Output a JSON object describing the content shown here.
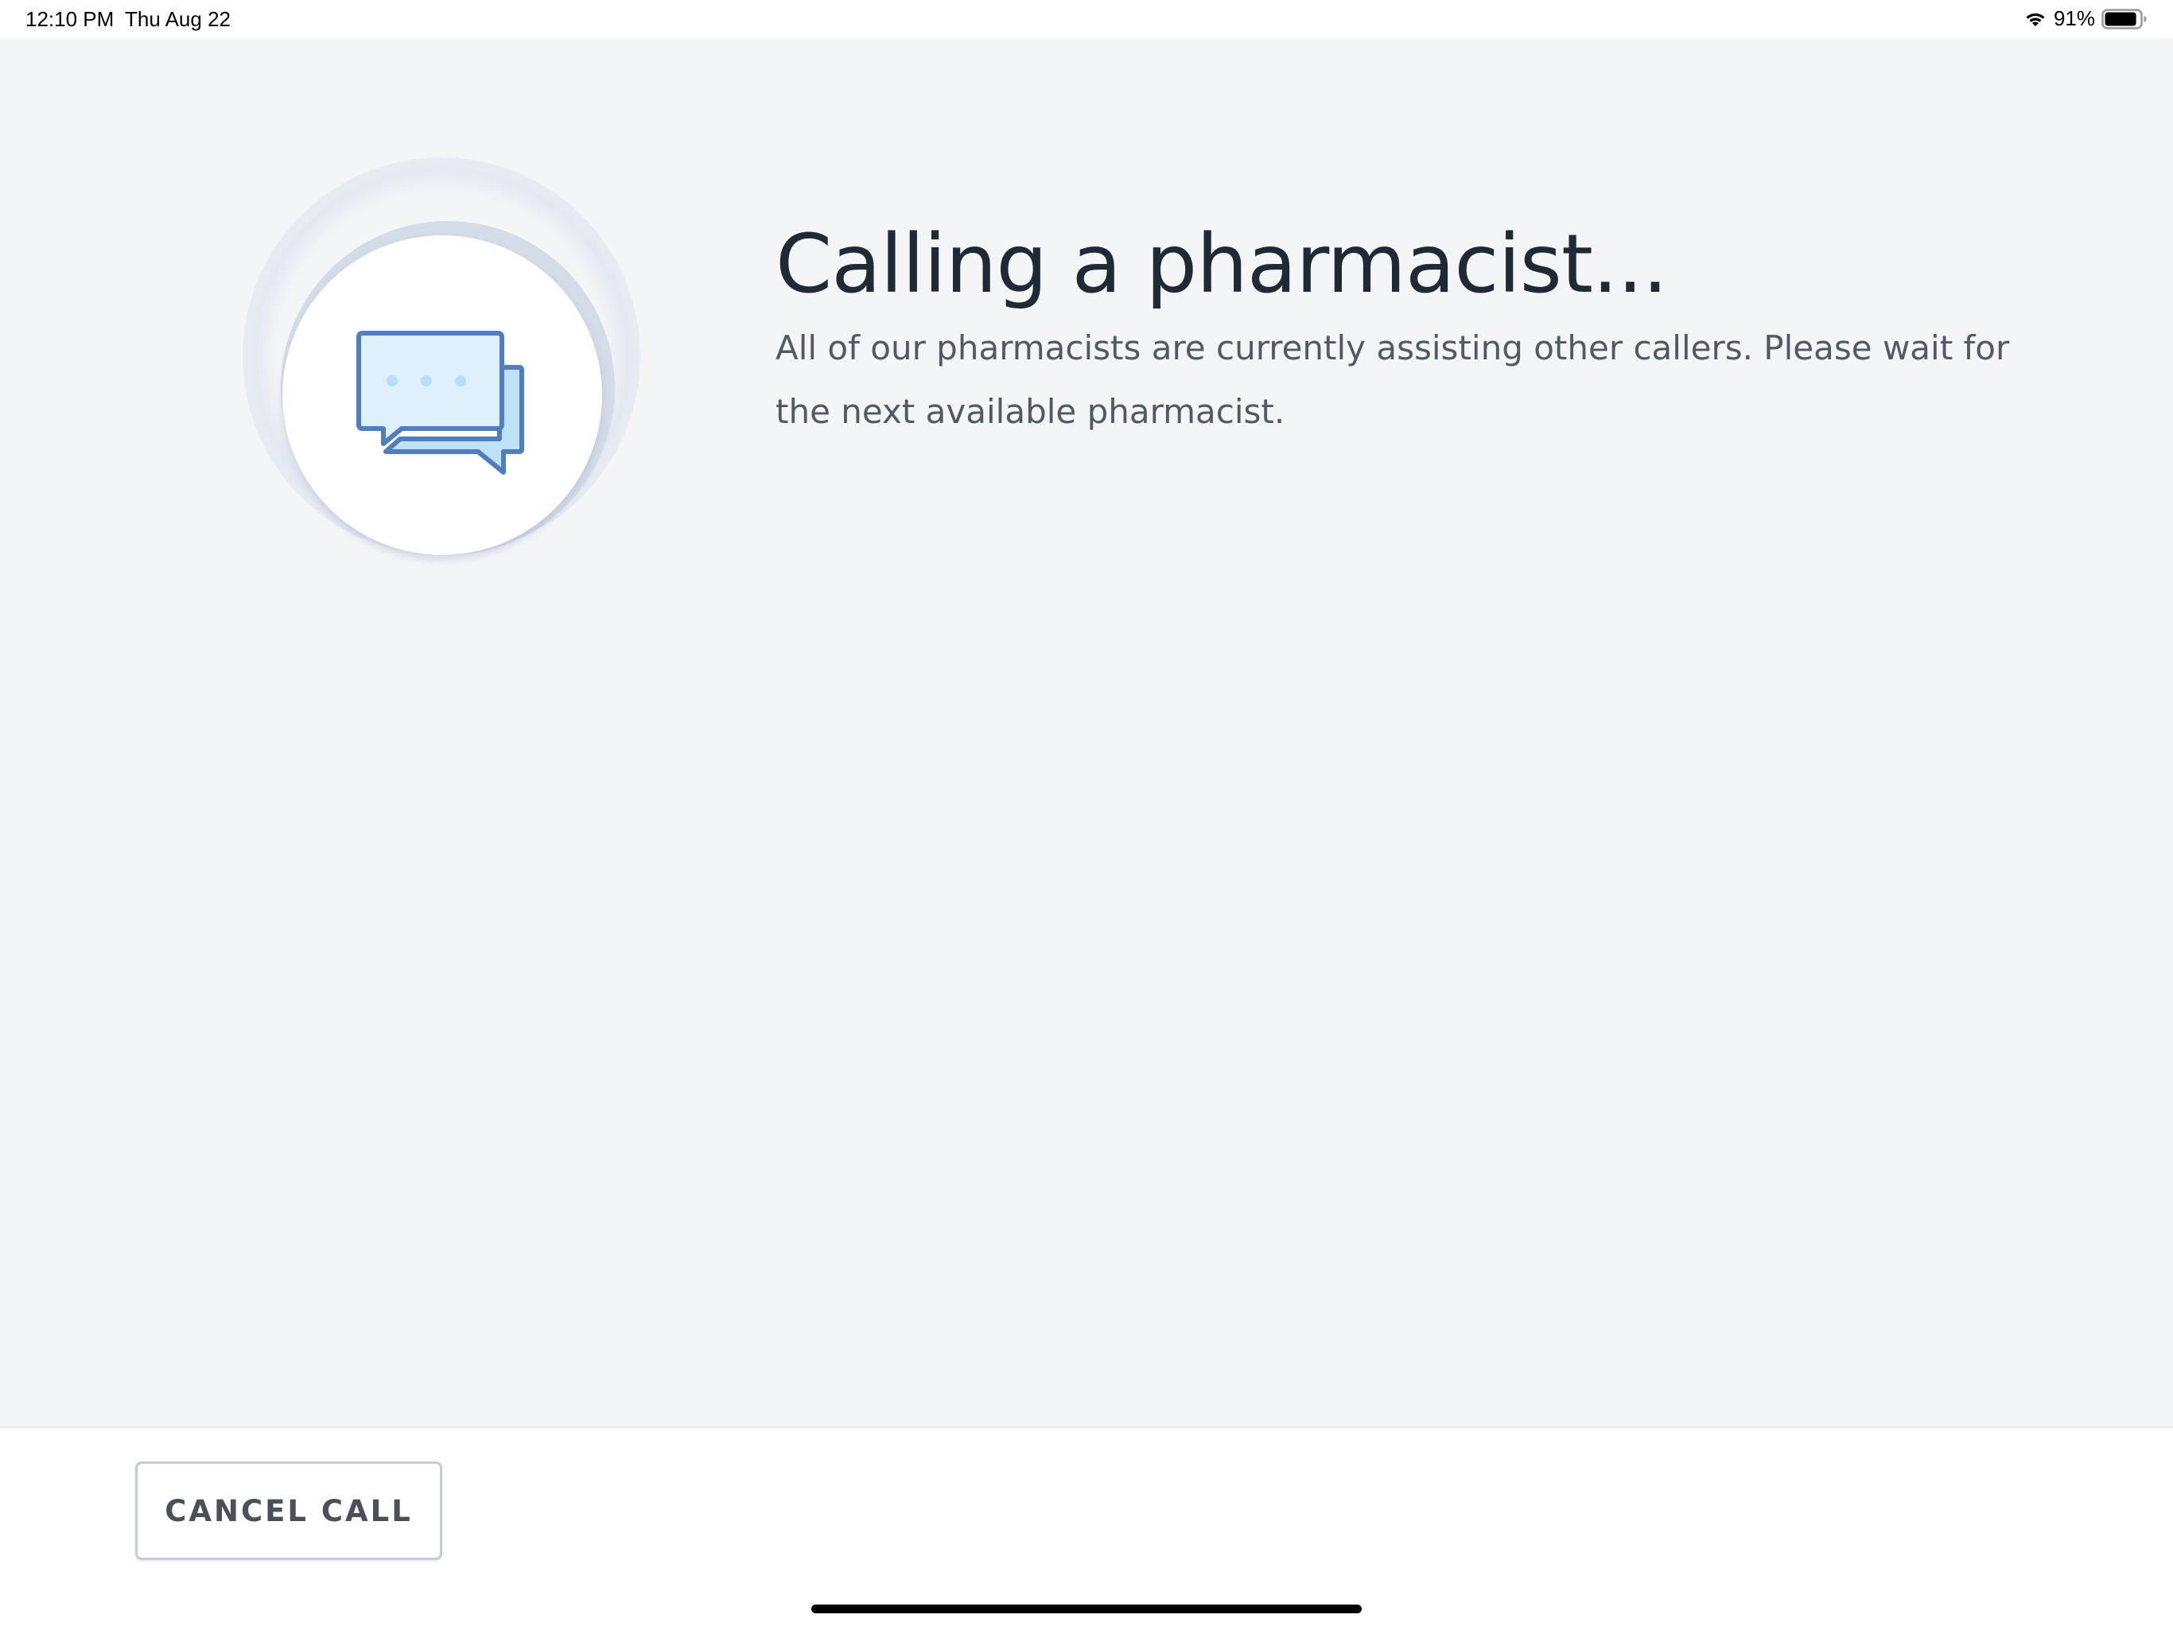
{
  "status_bar": {
    "time": "12:10 PM",
    "date": "Thu Aug 22",
    "battery_percent": "91%",
    "battery_level": 0.91,
    "icons": [
      "wifi-icon",
      "battery-icon"
    ]
  },
  "main": {
    "icon": "chat-bubbles-icon",
    "title": "Calling a pharmacist...",
    "message": "All of our pharmacists are currently assisting other callers. Please wait for the next available pharmacist."
  },
  "footer": {
    "cancel_label": "CANCEL CALL"
  },
  "colors": {
    "background": "#f4f5f7",
    "title": "#1f2a36",
    "body_text": "#515a63",
    "icon_stroke": "#4f7fc2",
    "icon_fill_front": "#ddf0fb",
    "icon_fill_back": "#bfe3f6",
    "button_border": "#c5ccd4"
  }
}
